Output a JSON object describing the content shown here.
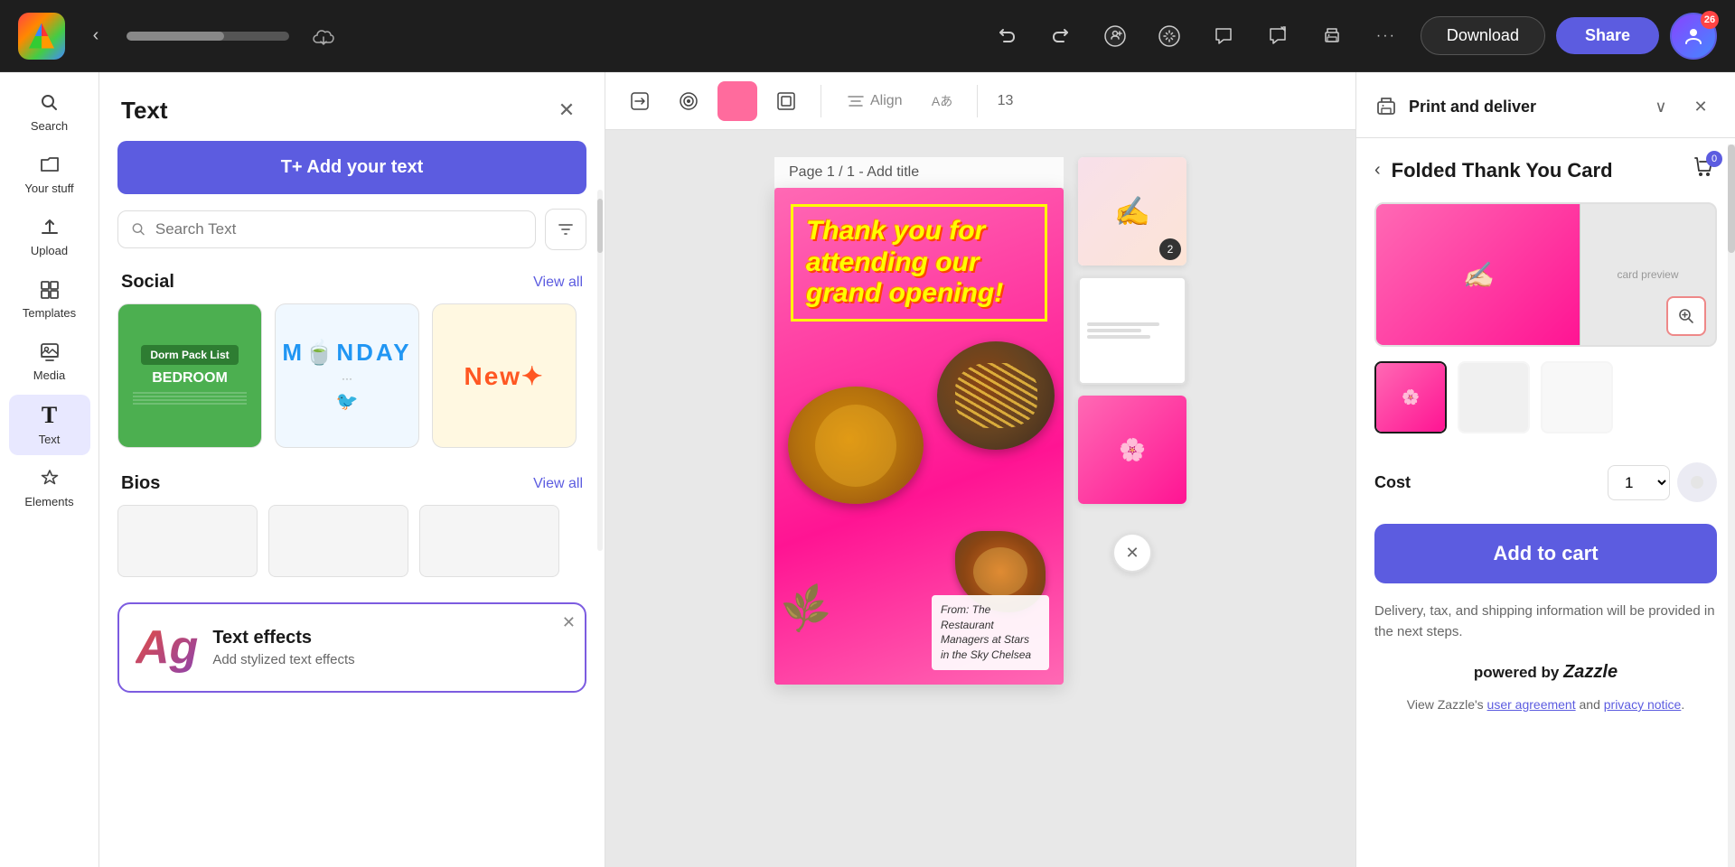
{
  "topbar": {
    "back_label": "‹",
    "cloud_icon": "☁",
    "undo_icon": "↩",
    "redo_icon": "↪",
    "add_collaborator_icon": "👤+",
    "bulb_icon": "💡",
    "comment_icon": "💬",
    "share_comment_icon": "💬↗",
    "print_icon": "🖨",
    "more_icon": "···",
    "download_label": "Download",
    "share_label": "Share",
    "avatar_badge": "26"
  },
  "sidebar": {
    "items": [
      {
        "id": "search",
        "icon": "🔍",
        "label": "Search"
      },
      {
        "id": "your-stuff",
        "icon": "📁",
        "label": "Your stuff"
      },
      {
        "id": "upload",
        "icon": "⬆",
        "label": "Upload"
      },
      {
        "id": "templates",
        "icon": "⊞",
        "label": "Templates"
      },
      {
        "id": "media",
        "icon": "⊟",
        "label": "Media"
      },
      {
        "id": "text",
        "icon": "T",
        "label": "Text",
        "active": true
      },
      {
        "id": "elements",
        "icon": "✦",
        "label": "Elements"
      }
    ]
  },
  "text_panel": {
    "title": "Text",
    "close_icon": "✕",
    "add_text_label": "T+  Add your text",
    "search_placeholder": "Search Text",
    "filter_icon": "⊿",
    "social_section": {
      "title": "Social",
      "view_all": "View all",
      "cards": [
        {
          "id": "dorm",
          "text": "Dorm Pack List\nBEDROOM",
          "bg": "#4caf50"
        },
        {
          "id": "monday",
          "text": "MONDAY",
          "bg": "#e8f4fd"
        },
        {
          "id": "new",
          "text": "New✦",
          "bg": "#fff3e0"
        }
      ]
    },
    "bios_section": {
      "title": "Bios",
      "view_all": "View all"
    },
    "text_effects": {
      "icon_char": "Ag",
      "title": "Text effects",
      "subtitle": "Add stylized text effects",
      "close_icon": "✕"
    }
  },
  "canvas": {
    "toolbar": {
      "replace_icon": "⊞",
      "style_icon": "⊙",
      "color_icon": "●",
      "frame_icon": "▣",
      "align_label": "Align",
      "translate_icon": "Aあ",
      "font_size": "13"
    },
    "page_label": "Page 1 / 1 - Add title",
    "design": {
      "thank_you_text": "Thank you for attending our grand opening!",
      "from_text": "From: The Restaurant Managers at Stars in the Sky Chelsea"
    }
  },
  "right_panel": {
    "header_title": "Print and deliver",
    "product_title": "Folded Thank You Card",
    "cart_badge": "0",
    "cost_label": "Cost",
    "quantity": "1",
    "add_to_cart_label": "Add to cart",
    "delivery_note": "Delivery, tax, and shipping information will be provided in the next steps.",
    "powered_by": "powered by Zazzle",
    "legal_text_prefix": "View Zazzle's ",
    "user_agreement_label": "user agreement",
    "and_text": " and ",
    "privacy_notice_label": "privacy notice",
    "legal_text_suffix": "."
  }
}
